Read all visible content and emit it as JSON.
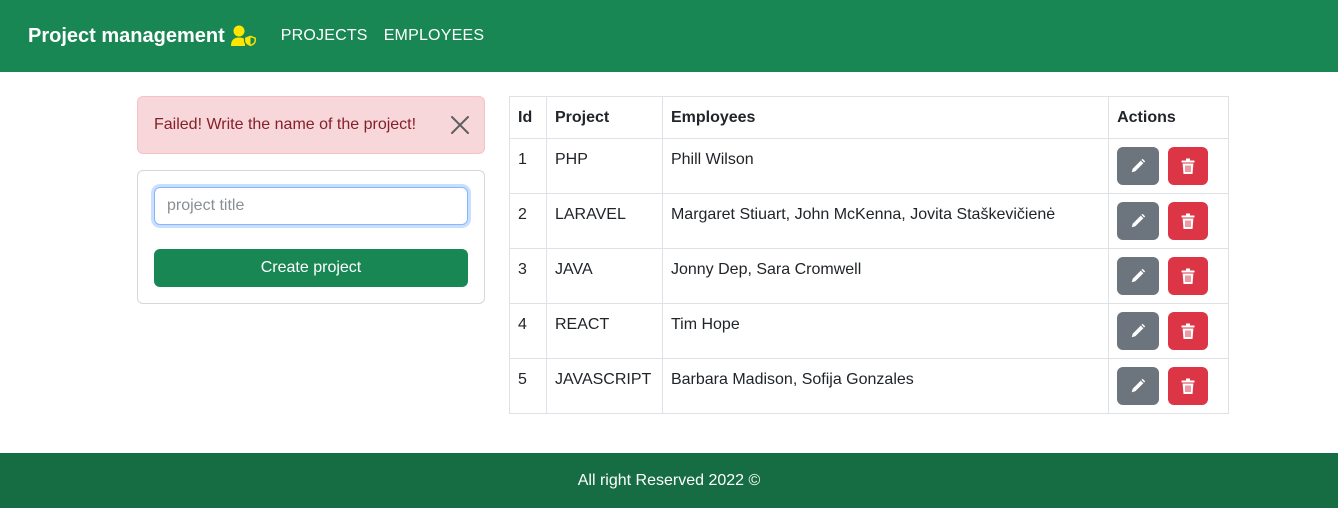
{
  "navbar": {
    "brand": "Project management",
    "brand_icon": "user-shield-icon",
    "links": [
      "PROJECTS",
      "EMPLOYEES"
    ],
    "bg_color": "#198754"
  },
  "alert": {
    "message": "Failed! Write the name of the project!",
    "close_icon": "close-icon"
  },
  "form": {
    "input_placeholder": "project title",
    "input_value": "",
    "submit_label": "Create project"
  },
  "table": {
    "headers": [
      "Id",
      "Project",
      "Employees",
      "Actions"
    ],
    "rows": [
      {
        "id": "1",
        "project": "PHP",
        "employees": "Phill Wilson"
      },
      {
        "id": "2",
        "project": "LARAVEL",
        "employees": "Margaret Stiuart, John McKenna, Jovita Staškevičienė"
      },
      {
        "id": "3",
        "project": "JAVA",
        "employees": "Jonny Dep, Sara Cromwell"
      },
      {
        "id": "4",
        "project": "REACT",
        "employees": "Tim Hope"
      },
      {
        "id": "5",
        "project": "JAVASCRIPT",
        "employees": "Barbara Madison, Sofija Gonzales"
      }
    ],
    "edit_icon": "pencil-icon",
    "delete_icon": "trash-icon",
    "edit_color": "#6c757d",
    "delete_color": "#dc3545"
  },
  "footer": {
    "text": "All right Reserved 2022 ©",
    "bg_color": "#166d43"
  }
}
